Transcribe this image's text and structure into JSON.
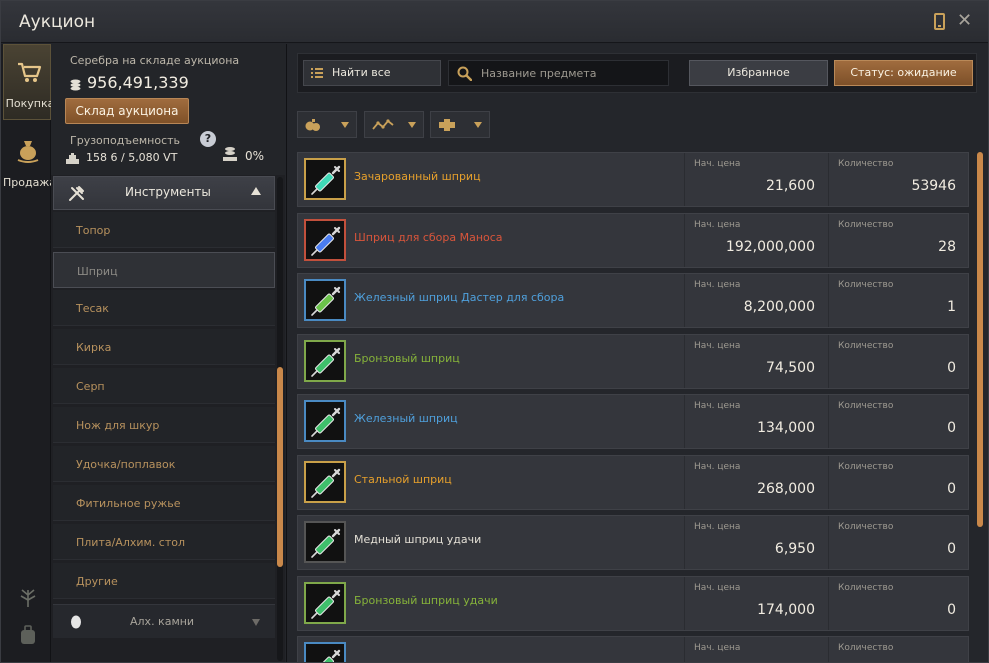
{
  "window": {
    "title": "Аукцион"
  },
  "modes": [
    {
      "label": "Покупка",
      "icon": "cart-icon",
      "active": true
    },
    {
      "label": "Продажа",
      "icon": "money-bag-icon",
      "active": false
    }
  ],
  "info": {
    "silver_label": "Серебра на складе аукциона",
    "silver_value": "956,491,339",
    "storage_button": "Склад аукциона",
    "capacity_label": "Грузоподъемность",
    "help": "?",
    "weight_value": "158 6 / 5,080 VT",
    "percent_value": "0%"
  },
  "categories": {
    "header": "Инструменты",
    "items": [
      {
        "label": "Топор"
      },
      {
        "label": "Шприц",
        "selected": true
      },
      {
        "label": "Тесак"
      },
      {
        "label": "Кирка"
      },
      {
        "label": "Серп"
      },
      {
        "label": "Нож для шкур"
      },
      {
        "label": "Удочка/поплавок"
      },
      {
        "label": "Фитильное ружье"
      },
      {
        "label": "Плита/Алхим. стол"
      },
      {
        "label": "Другие"
      }
    ],
    "next_header": "Алх. камни"
  },
  "toolbar": {
    "find_label": "Найти все",
    "search_placeholder": "Название предмета",
    "favorites_label": "Избранное",
    "status_label": "Статус: ожидание"
  },
  "filters": [
    {
      "icon": "coin-pouch-icon"
    },
    {
      "icon": "trend-line-icon"
    },
    {
      "icon": "cross-icon"
    }
  ],
  "columns": {
    "price": "Нач. цена",
    "qty": "Количество"
  },
  "items": [
    {
      "name": "Зачарованный шприц",
      "price": "21,600",
      "qty": "53946",
      "color": "#e6a02c",
      "frame": "#c9a049",
      "liquid": "#3fd9b7"
    },
    {
      "name": "Шприц для сбора Маноса",
      "price": "192,000,000",
      "qty": "28",
      "color": "#d9553b",
      "frame": "#c2503c",
      "liquid": "#4a7cf0"
    },
    {
      "name": "Железный шприц Дастер для сбора",
      "price": "8,200,000",
      "qty": "1",
      "color": "#4fa0dc",
      "frame": "#4a8ac2",
      "liquid": "#6bc24a"
    },
    {
      "name": "Бронзовый шприц",
      "price": "74,500",
      "qty": "0",
      "color": "#86b33a",
      "frame": "#7fa84a",
      "liquid": "#3fbf6b"
    },
    {
      "name": "Железный шприц",
      "price": "134,000",
      "qty": "0",
      "color": "#4fa0dc",
      "frame": "#4a8ac2",
      "liquid": "#3fbf6b"
    },
    {
      "name": "Стальной шприц",
      "price": "268,000",
      "qty": "0",
      "color": "#e6a02c",
      "frame": "#c9a049",
      "liquid": "#3fbf6b"
    },
    {
      "name": "Медный шприц удачи",
      "price": "6,950",
      "qty": "0",
      "color": "#e4e0d6",
      "frame": "#555555",
      "liquid": "#3fbf6b"
    },
    {
      "name": "Бронзовый шприц удачи",
      "price": "174,000",
      "qty": "0",
      "color": "#86b33a",
      "frame": "#7fa84a",
      "liquid": "#3fbf6b"
    },
    {
      "name": "",
      "price": "",
      "qty": "",
      "color": "#e4e0d6",
      "frame": "#4a8ac2",
      "liquid": "#3fbf6b"
    }
  ]
}
